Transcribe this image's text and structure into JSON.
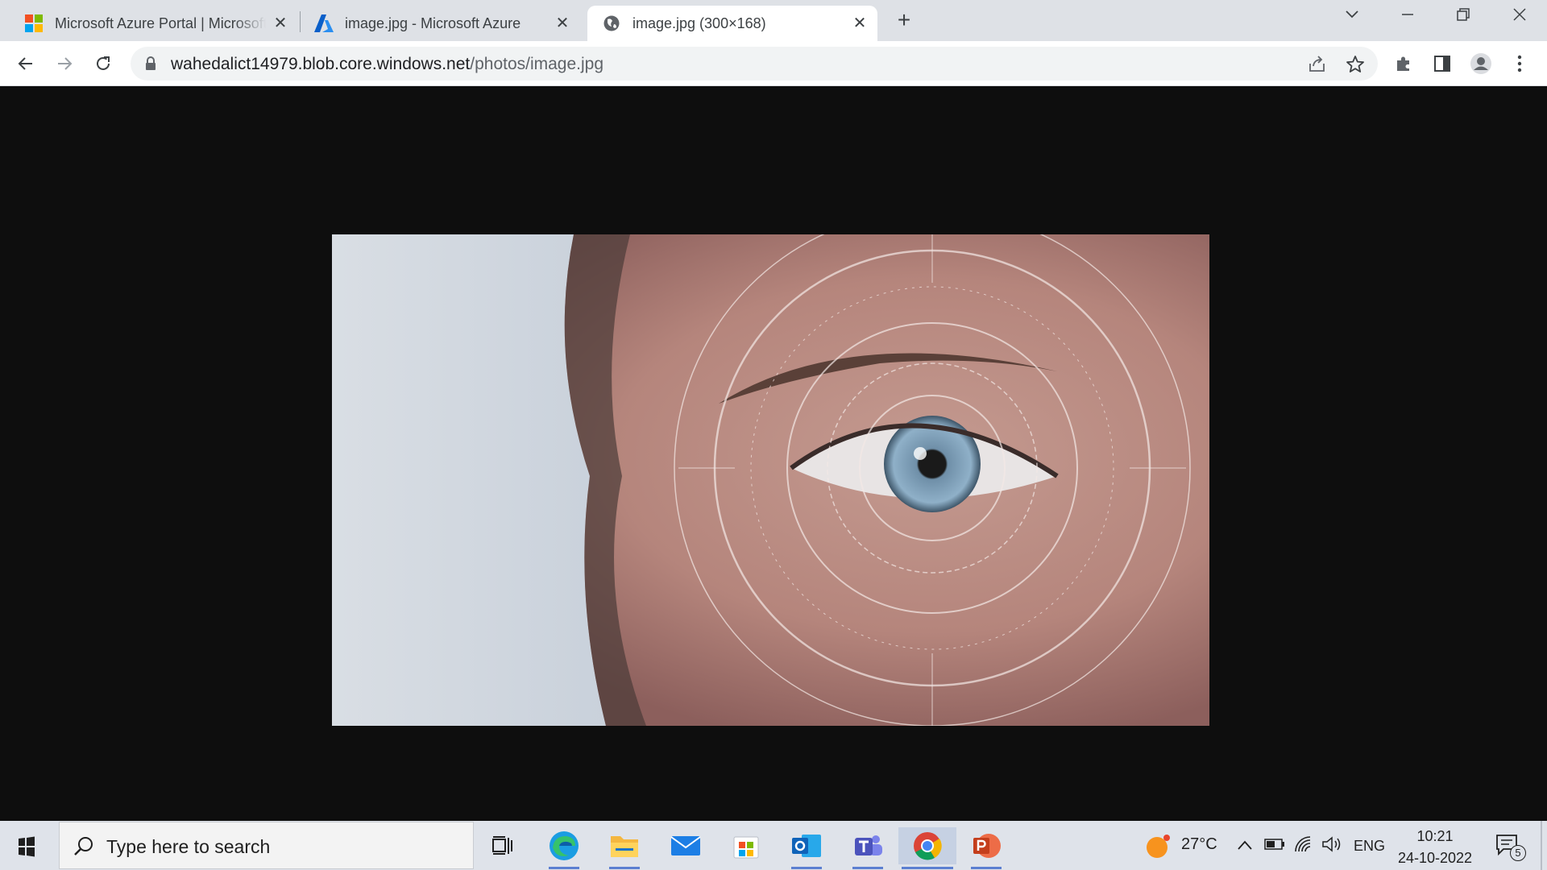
{
  "browser": {
    "tabs": [
      {
        "title": "Microsoft Azure Portal | Microsoft Azure",
        "favicon": "microsoft-logo-icon",
        "active": false
      },
      {
        "title": "image.jpg - Microsoft Azure",
        "favicon": "azure-logo-icon",
        "active": false
      },
      {
        "title": "image.jpg (300×168)",
        "favicon": "globe-icon",
        "active": true
      }
    ],
    "address": {
      "host": "wahedalict14979.blob.core.windows.net",
      "path": "/photos/image.jpg"
    }
  },
  "content": {
    "image_description_icon": "image-viewer-photo"
  },
  "taskbar": {
    "search_placeholder": "Type here to search",
    "apps": [
      "task-view-icon",
      "edge-icon",
      "file-explorer-icon",
      "mail-icon",
      "microsoft-store-icon",
      "outlook-icon",
      "teams-icon",
      "chrome-icon",
      "powerpoint-icon"
    ],
    "weather": "27°C",
    "language": "ENG",
    "time": "10:21",
    "date": "24-10-2022",
    "notification_count": "5"
  },
  "colors": {
    "tabstrip_bg": "#dee1e6",
    "content_bg": "#0e0e0e",
    "taskbar_bg": "#dfe3ea",
    "accent": "#5b7fd1"
  }
}
